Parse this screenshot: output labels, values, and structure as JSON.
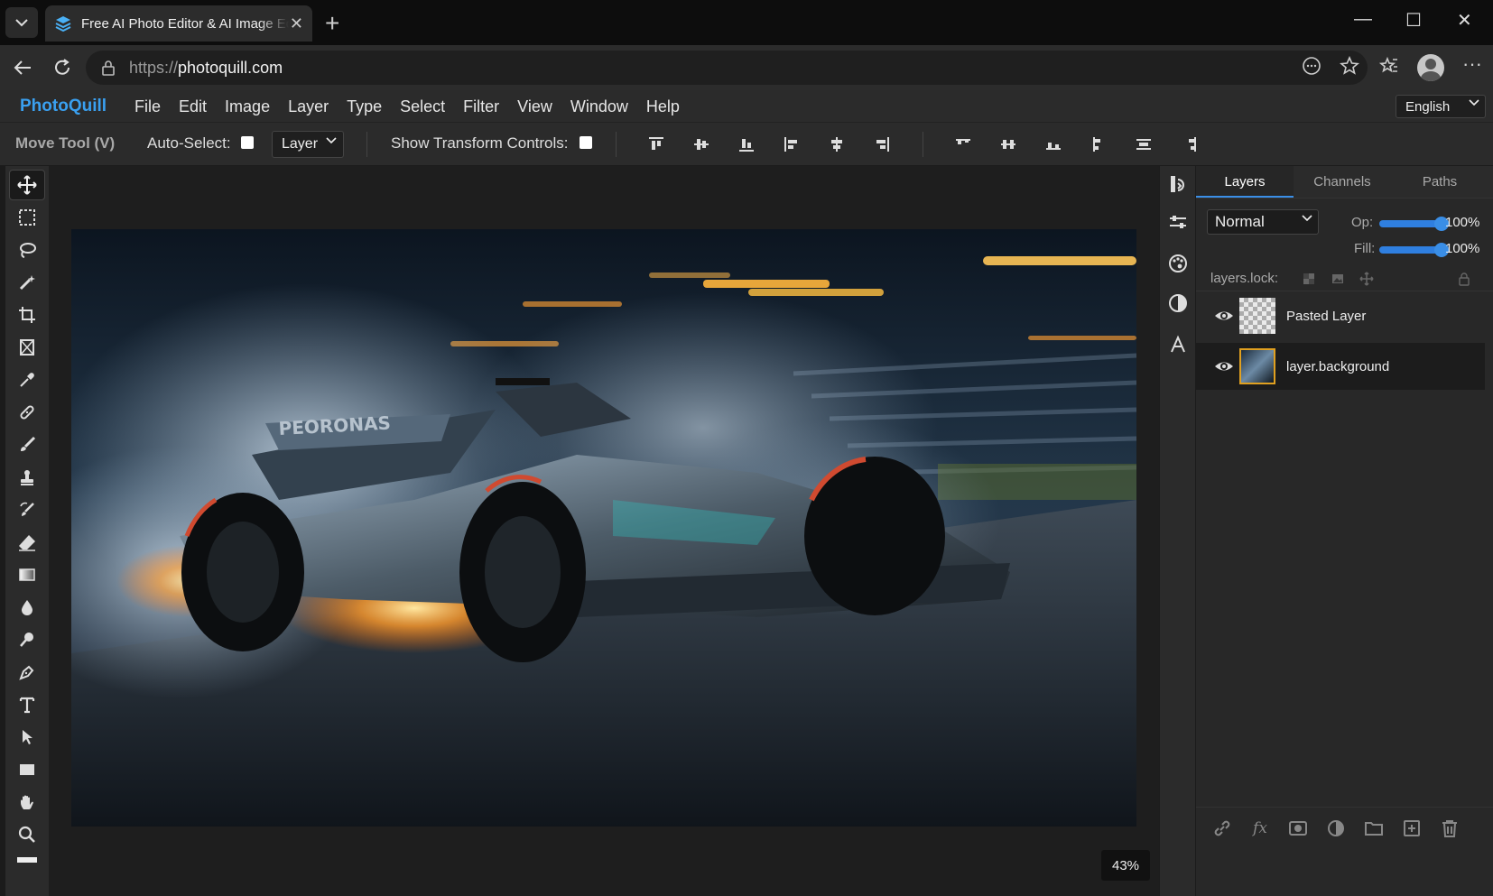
{
  "browser": {
    "tab_title": "Free AI Photo Editor & AI Image Editor",
    "url_protocol": "https://",
    "url_host": "photoquill.com"
  },
  "app": {
    "brand": "PhotoQuill",
    "menu": [
      "File",
      "Edit",
      "Image",
      "Layer",
      "Type",
      "Select",
      "Filter",
      "View",
      "Window",
      "Help"
    ],
    "language": "English"
  },
  "options": {
    "tool_name": "Move Tool (V)",
    "auto_select_label": "Auto-Select:",
    "auto_select_target": "Layer",
    "transform_controls_label": "Show Transform Controls:"
  },
  "canvas": {
    "zoom": "43%"
  },
  "layers_panel": {
    "tabs": [
      "Layers",
      "Channels",
      "Paths"
    ],
    "active_tab": "Layers",
    "blend_mode": "Normal",
    "opacity_label": "Op:",
    "opacity_value": "100%",
    "fill_label": "Fill:",
    "fill_value": "100%",
    "lock_label": "layers.lock:",
    "layers": [
      {
        "name": "Pasted Layer",
        "selected": false
      },
      {
        "name": "layer.background",
        "selected": true
      }
    ]
  },
  "colors": {
    "accent": "#3a8ee6",
    "brand": "#3aa0f0"
  }
}
